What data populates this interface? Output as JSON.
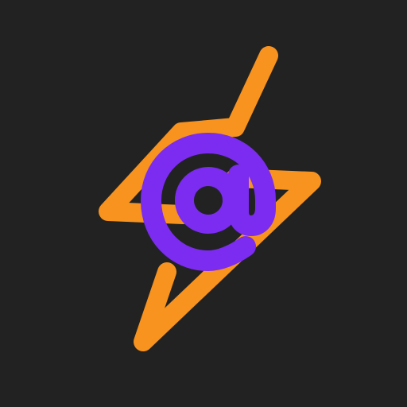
{
  "icon": {
    "name": "bolt-at-sign-logo",
    "glyph": "@",
    "colors": {
      "background": "#222222",
      "bolt": "#F7931E",
      "at_sign": "#7B2CF0"
    }
  }
}
